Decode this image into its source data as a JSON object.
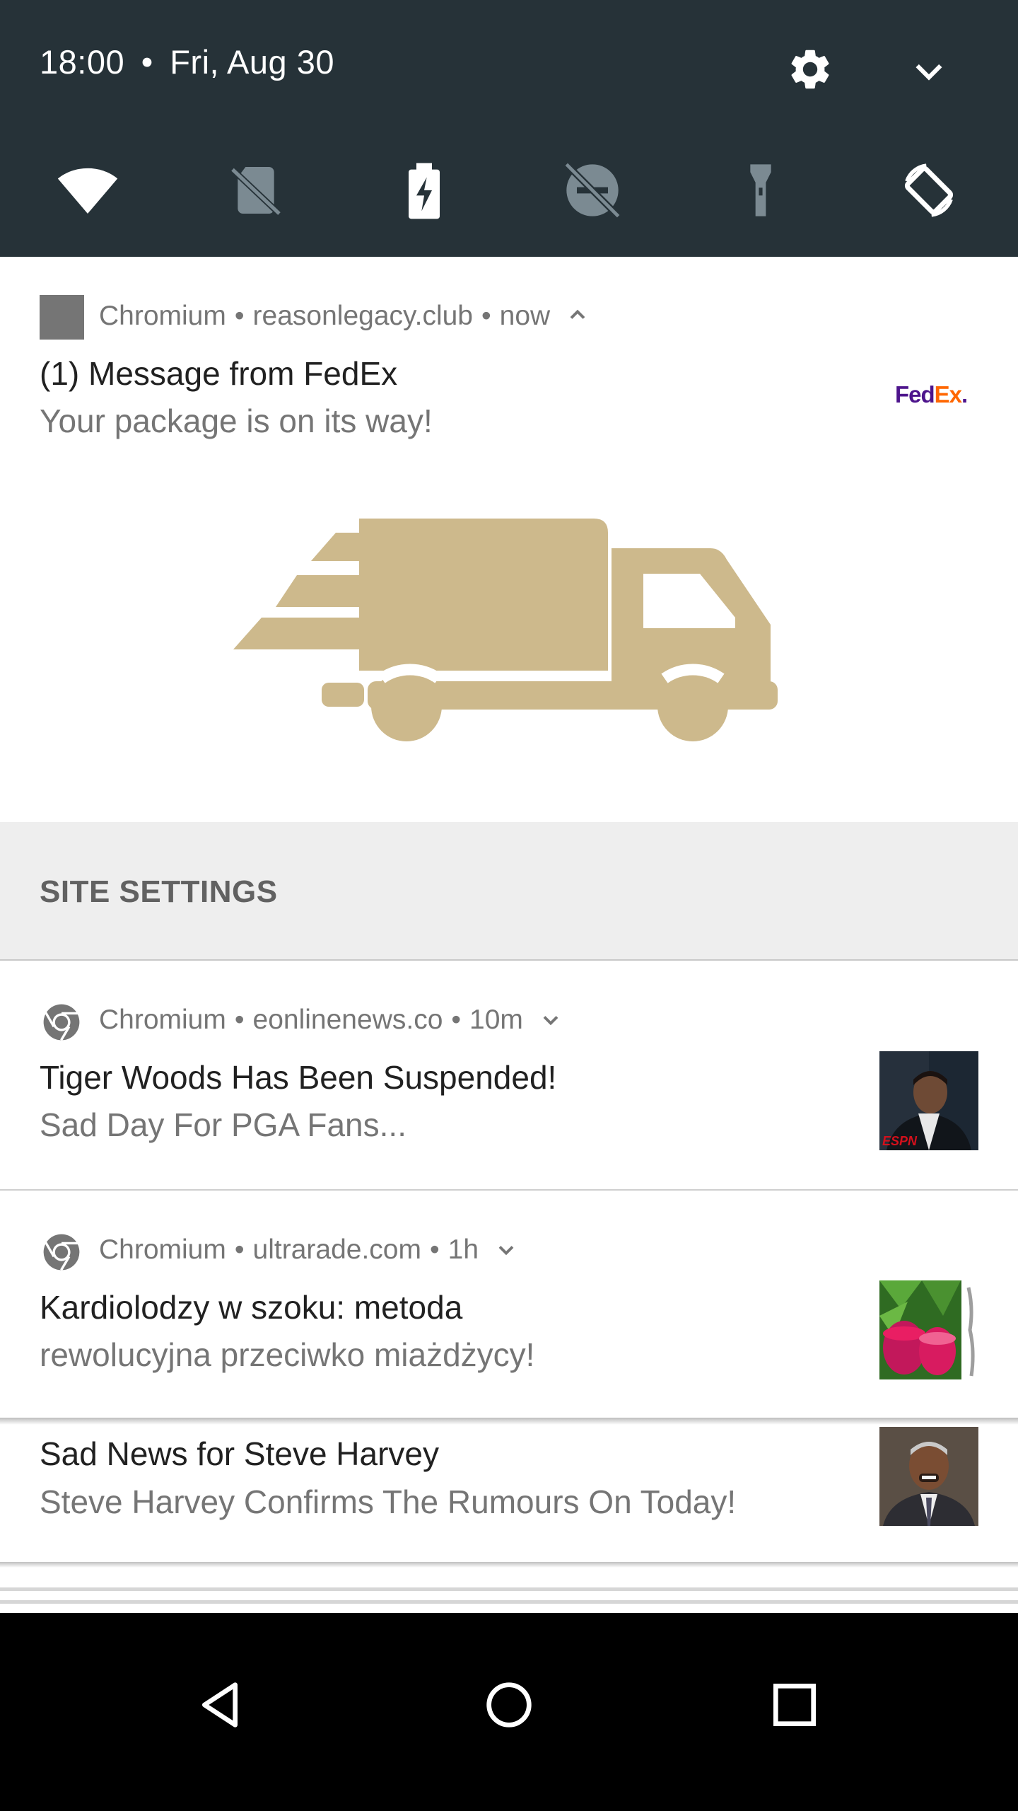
{
  "status": {
    "time": "18:00",
    "separator": "•",
    "date": "Fri, Aug 30"
  },
  "quick_settings": {
    "tiles": [
      "wifi-icon",
      "no-sim-icon",
      "battery-charging-icon",
      "do-not-disturb-off-icon",
      "flashlight-icon",
      "auto-rotate-icon"
    ]
  },
  "notifications": [
    {
      "app": "Chromium",
      "site": "reasonlegacy.club",
      "time": "now",
      "title": "(1) Message from FedEx",
      "text": "Your package is on its way!",
      "logo_text_fed": "Fed",
      "logo_text_ex": "Ex",
      "logo_text_dot": "."
    },
    {
      "app": "Chromium",
      "site": "eonlinenews.co",
      "time": "10m",
      "title": "Tiger Woods Has Been Suspended!",
      "text": "Sad Day For PGA Fans..."
    },
    {
      "app": "Chromium",
      "site": "ultrarade.com",
      "time": "1h",
      "title": "Kardiolodzy w szoku: metoda",
      "text": "rewolucyjna przeciwko miażdżycy!"
    },
    {
      "title": "Sad News for Steve Harvey",
      "text": "Steve Harvey Confirms The Rumours On Today!"
    }
  ],
  "site_settings_label": "SITE SETTINGS",
  "thumb_espn": "ESPN",
  "colors": {
    "qs_background": "#263238",
    "truck": "#cdb98c",
    "fedex_purple": "#4d148c",
    "fedex_orange": "#ff6600"
  }
}
